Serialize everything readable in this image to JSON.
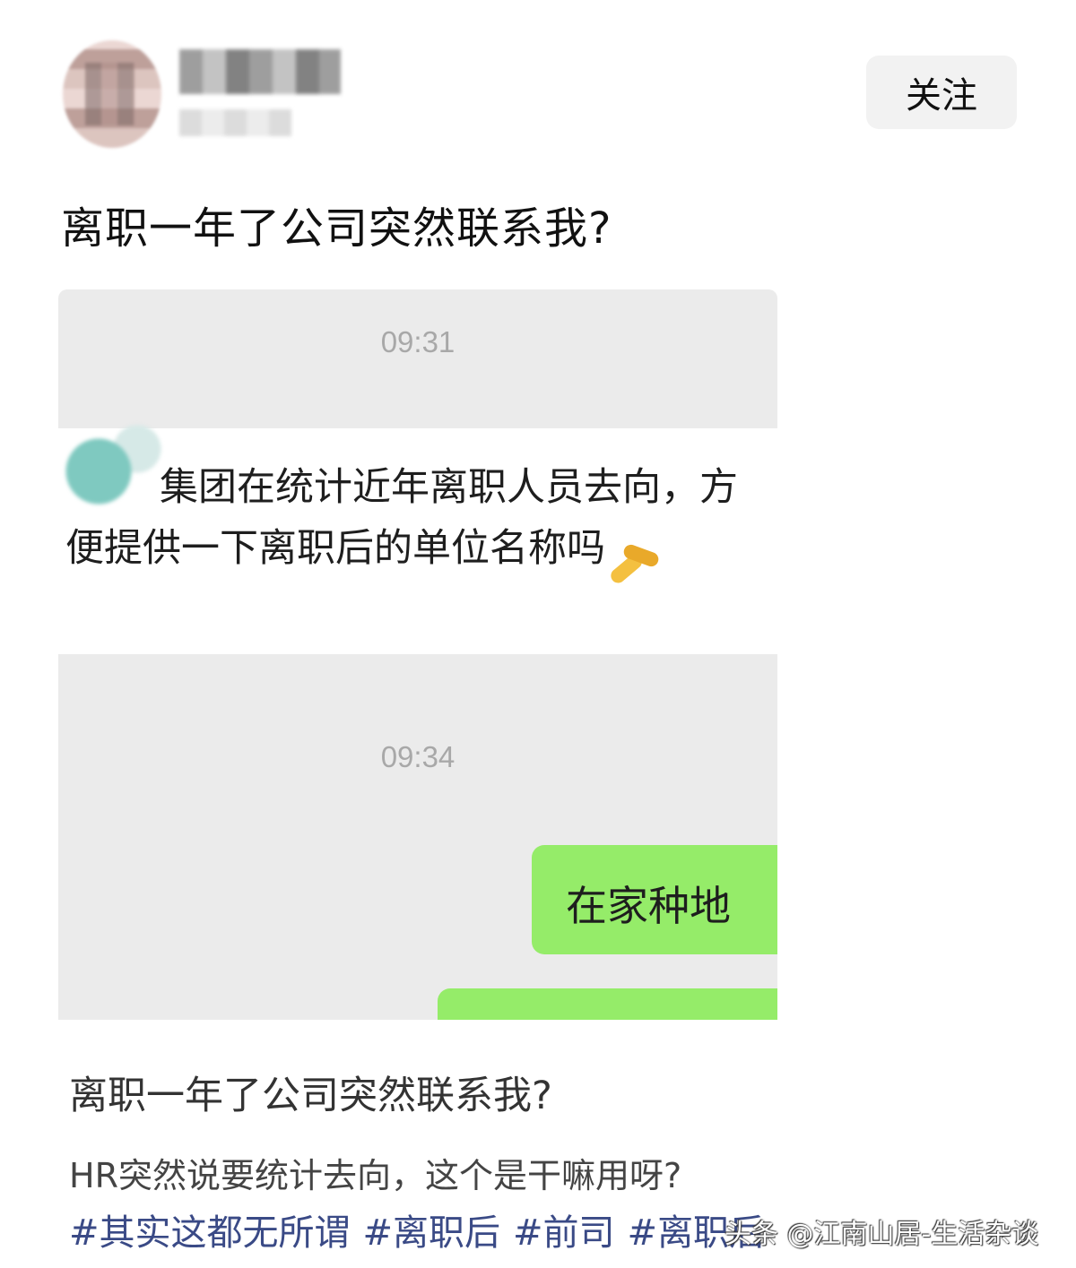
{
  "header": {
    "follow_label": "关注"
  },
  "post": {
    "title": "离职一年了公司突然联系我?"
  },
  "chat": {
    "time_1": "09:31",
    "incoming_message": "集团在统计近年离职人员去向，方便提供一下离职后的单位名称吗",
    "time_2": "09:34",
    "reply_1": "在家种地"
  },
  "card": {
    "title": "离职一年了公司突然联系我?",
    "description": "HR突然说要统计去向，这个是干嘛用呀?",
    "tags": [
      "#其实这都无所谓",
      "#离职后",
      "#前司",
      "#离职后"
    ]
  },
  "watermark": "头条 @江南山居-生活杂谈",
  "colors": {
    "chat_background": "#ebebeb",
    "outgoing_bubble": "#95ec69",
    "tag_color": "#3a4a86"
  }
}
